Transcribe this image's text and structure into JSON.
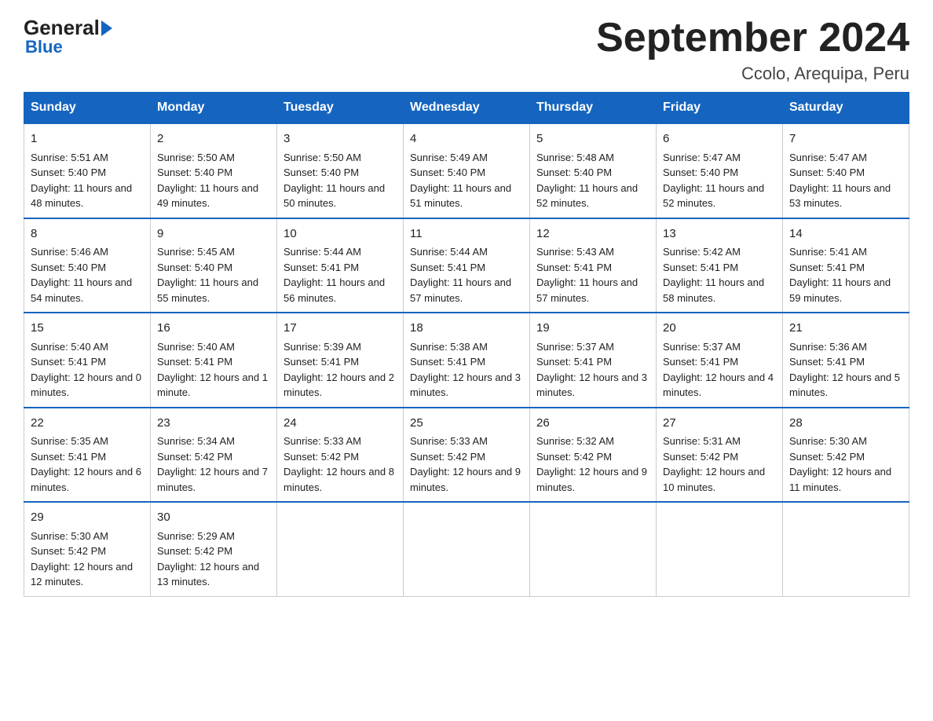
{
  "logo": {
    "general": "General",
    "blue": "Blue"
  },
  "title": "September 2024",
  "subtitle": "Ccolo, Arequipa, Peru",
  "days_of_week": [
    "Sunday",
    "Monday",
    "Tuesday",
    "Wednesday",
    "Thursday",
    "Friday",
    "Saturday"
  ],
  "weeks": [
    [
      {
        "day": "1",
        "sunrise": "5:51 AM",
        "sunset": "5:40 PM",
        "daylight": "11 hours and 48 minutes."
      },
      {
        "day": "2",
        "sunrise": "5:50 AM",
        "sunset": "5:40 PM",
        "daylight": "11 hours and 49 minutes."
      },
      {
        "day": "3",
        "sunrise": "5:50 AM",
        "sunset": "5:40 PM",
        "daylight": "11 hours and 50 minutes."
      },
      {
        "day": "4",
        "sunrise": "5:49 AM",
        "sunset": "5:40 PM",
        "daylight": "11 hours and 51 minutes."
      },
      {
        "day": "5",
        "sunrise": "5:48 AM",
        "sunset": "5:40 PM",
        "daylight": "11 hours and 52 minutes."
      },
      {
        "day": "6",
        "sunrise": "5:47 AM",
        "sunset": "5:40 PM",
        "daylight": "11 hours and 52 minutes."
      },
      {
        "day": "7",
        "sunrise": "5:47 AM",
        "sunset": "5:40 PM",
        "daylight": "11 hours and 53 minutes."
      }
    ],
    [
      {
        "day": "8",
        "sunrise": "5:46 AM",
        "sunset": "5:40 PM",
        "daylight": "11 hours and 54 minutes."
      },
      {
        "day": "9",
        "sunrise": "5:45 AM",
        "sunset": "5:40 PM",
        "daylight": "11 hours and 55 minutes."
      },
      {
        "day": "10",
        "sunrise": "5:44 AM",
        "sunset": "5:41 PM",
        "daylight": "11 hours and 56 minutes."
      },
      {
        "day": "11",
        "sunrise": "5:44 AM",
        "sunset": "5:41 PM",
        "daylight": "11 hours and 57 minutes."
      },
      {
        "day": "12",
        "sunrise": "5:43 AM",
        "sunset": "5:41 PM",
        "daylight": "11 hours and 57 minutes."
      },
      {
        "day": "13",
        "sunrise": "5:42 AM",
        "sunset": "5:41 PM",
        "daylight": "11 hours and 58 minutes."
      },
      {
        "day": "14",
        "sunrise": "5:41 AM",
        "sunset": "5:41 PM",
        "daylight": "11 hours and 59 minutes."
      }
    ],
    [
      {
        "day": "15",
        "sunrise": "5:40 AM",
        "sunset": "5:41 PM",
        "daylight": "12 hours and 0 minutes."
      },
      {
        "day": "16",
        "sunrise": "5:40 AM",
        "sunset": "5:41 PM",
        "daylight": "12 hours and 1 minute."
      },
      {
        "day": "17",
        "sunrise": "5:39 AM",
        "sunset": "5:41 PM",
        "daylight": "12 hours and 2 minutes."
      },
      {
        "day": "18",
        "sunrise": "5:38 AM",
        "sunset": "5:41 PM",
        "daylight": "12 hours and 3 minutes."
      },
      {
        "day": "19",
        "sunrise": "5:37 AM",
        "sunset": "5:41 PM",
        "daylight": "12 hours and 3 minutes."
      },
      {
        "day": "20",
        "sunrise": "5:37 AM",
        "sunset": "5:41 PM",
        "daylight": "12 hours and 4 minutes."
      },
      {
        "day": "21",
        "sunrise": "5:36 AM",
        "sunset": "5:41 PM",
        "daylight": "12 hours and 5 minutes."
      }
    ],
    [
      {
        "day": "22",
        "sunrise": "5:35 AM",
        "sunset": "5:41 PM",
        "daylight": "12 hours and 6 minutes."
      },
      {
        "day": "23",
        "sunrise": "5:34 AM",
        "sunset": "5:42 PM",
        "daylight": "12 hours and 7 minutes."
      },
      {
        "day": "24",
        "sunrise": "5:33 AM",
        "sunset": "5:42 PM",
        "daylight": "12 hours and 8 minutes."
      },
      {
        "day": "25",
        "sunrise": "5:33 AM",
        "sunset": "5:42 PM",
        "daylight": "12 hours and 9 minutes."
      },
      {
        "day": "26",
        "sunrise": "5:32 AM",
        "sunset": "5:42 PM",
        "daylight": "12 hours and 9 minutes."
      },
      {
        "day": "27",
        "sunrise": "5:31 AM",
        "sunset": "5:42 PM",
        "daylight": "12 hours and 10 minutes."
      },
      {
        "day": "28",
        "sunrise": "5:30 AM",
        "sunset": "5:42 PM",
        "daylight": "12 hours and 11 minutes."
      }
    ],
    [
      {
        "day": "29",
        "sunrise": "5:30 AM",
        "sunset": "5:42 PM",
        "daylight": "12 hours and 12 minutes."
      },
      {
        "day": "30",
        "sunrise": "5:29 AM",
        "sunset": "5:42 PM",
        "daylight": "12 hours and 13 minutes."
      },
      null,
      null,
      null,
      null,
      null
    ]
  ]
}
